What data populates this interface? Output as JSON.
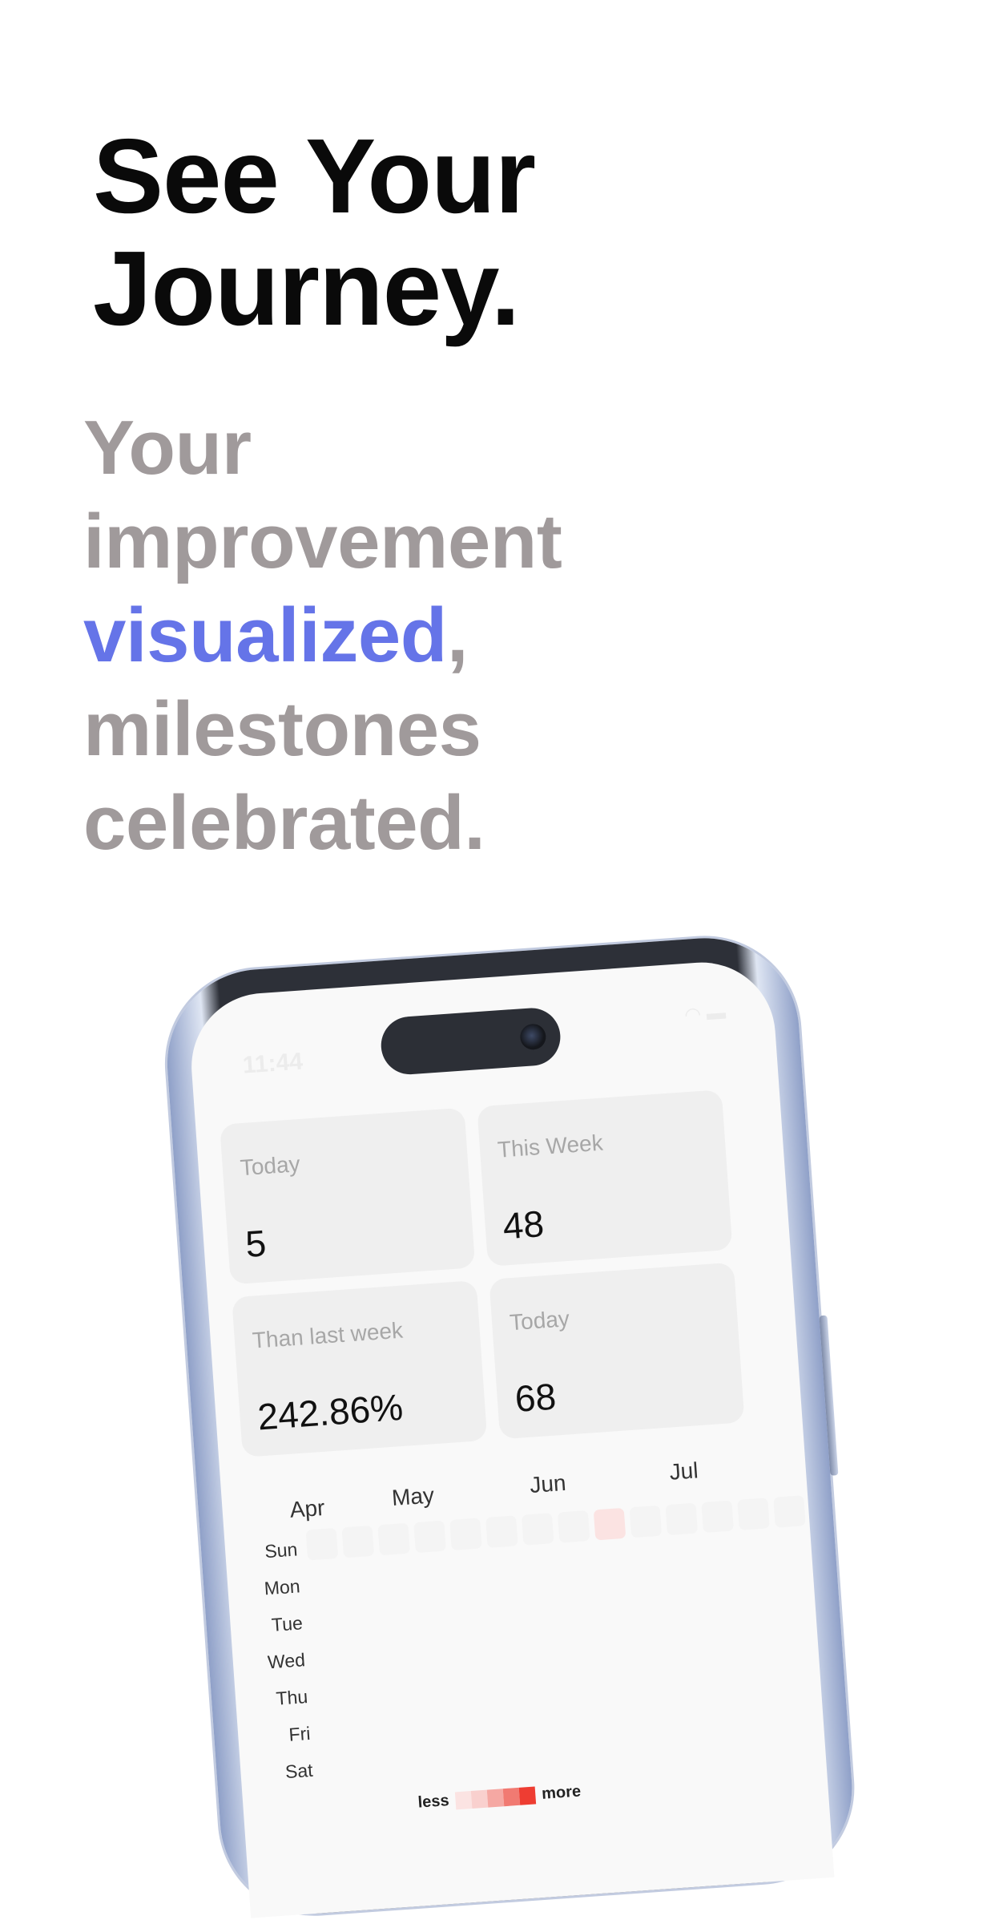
{
  "headline": {
    "line1": "See Your",
    "line2": "Journey."
  },
  "subhead": {
    "line1": "Your",
    "line2": "improvement",
    "accent": "visualized",
    "comma": ",",
    "line4": "milestones",
    "line5": "celebrated."
  },
  "colors": {
    "accent": "#6574e8",
    "subtext": "#a09a9b",
    "heat_high": "#ee3d32",
    "heat_low": "#fbe3e2"
  },
  "phone": {
    "status_time": "11:44",
    "cards": [
      {
        "label": "Today",
        "value": "5"
      },
      {
        "label": "This Week",
        "value": "48"
      },
      {
        "label": "Than last week",
        "value": "242.86%"
      },
      {
        "label": "Today",
        "value": "68"
      }
    ],
    "heatmap": {
      "months": [
        "Apr",
        "May",
        "Jun",
        "Jul"
      ],
      "days": [
        "Sun",
        "Mon",
        "Tue",
        "Wed",
        "Thu",
        "Fri",
        "Sat"
      ],
      "legend_less": "less",
      "legend_more": "more"
    }
  }
}
